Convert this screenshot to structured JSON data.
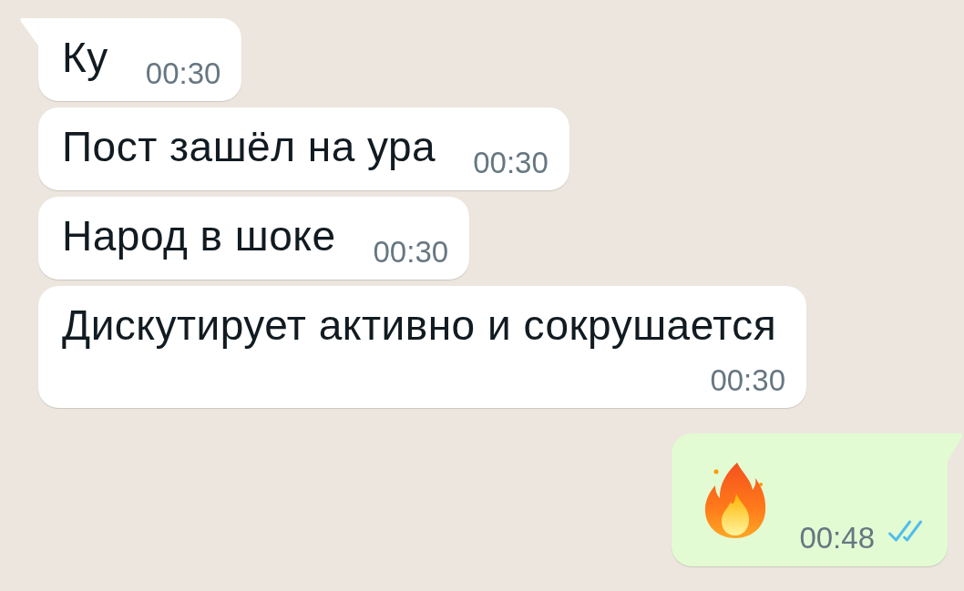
{
  "messages": [
    {
      "kind": "text",
      "outgoing": false,
      "tail": true,
      "text": "Ку",
      "time": "00:30"
    },
    {
      "kind": "text",
      "outgoing": false,
      "tail": false,
      "text": "Пост зашёл на ура",
      "time": "00:30"
    },
    {
      "kind": "text",
      "outgoing": false,
      "tail": false,
      "text": "Народ в шоке",
      "time": "00:30"
    },
    {
      "kind": "text",
      "outgoing": false,
      "tail": false,
      "text": "Дискутирует активно и сокрушается",
      "time": "00:30"
    },
    {
      "kind": "emoji",
      "outgoing": true,
      "tail": true,
      "time": "00:48",
      "read": true
    }
  ]
}
